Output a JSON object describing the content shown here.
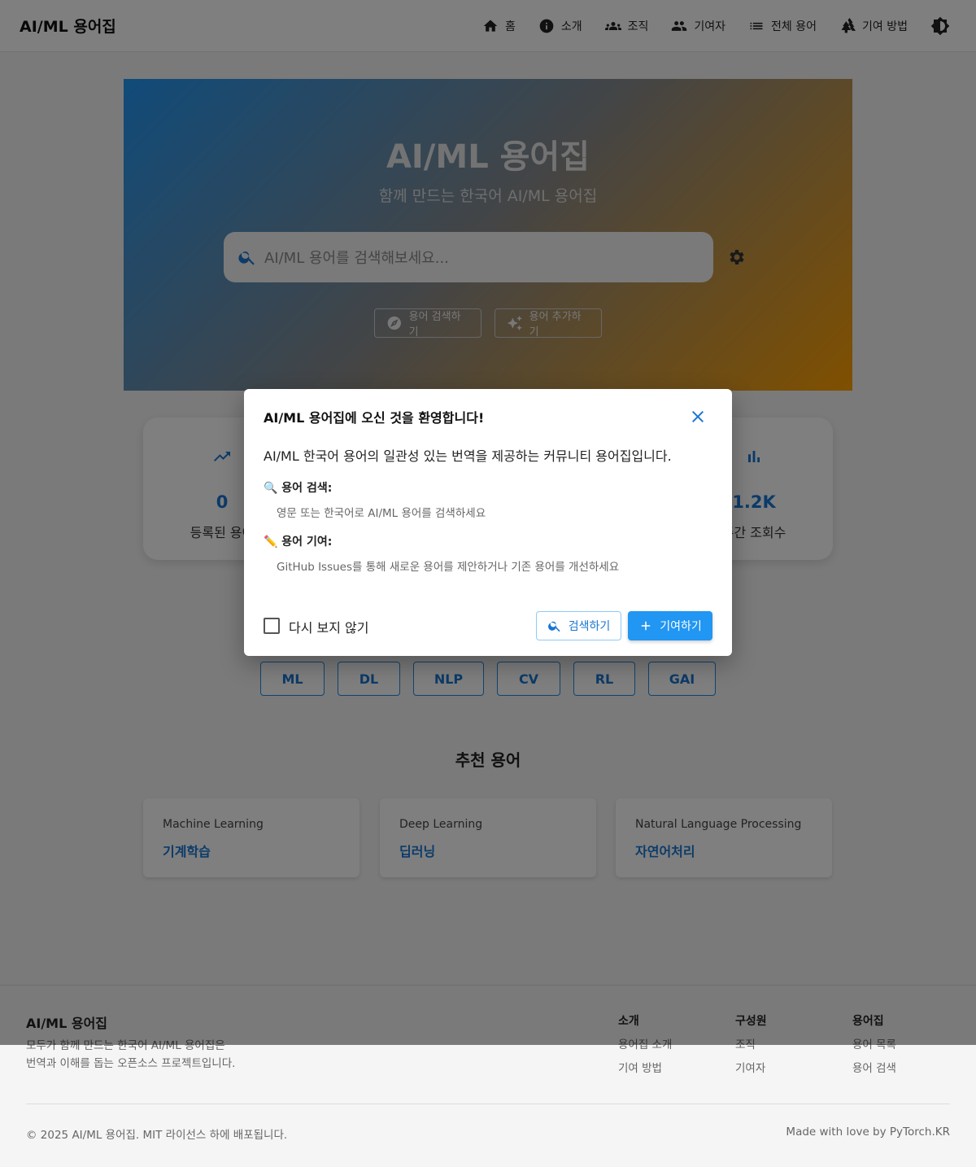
{
  "header": {
    "brand": "AI/ML 용어집",
    "nav": [
      {
        "label": "홈",
        "icon": "home-icon"
      },
      {
        "label": "소개",
        "icon": "info-icon"
      },
      {
        "label": "조직",
        "icon": "groups-icon"
      },
      {
        "label": "기여자",
        "icon": "people-icon"
      },
      {
        "label": "전체 용어",
        "icon": "list-icon"
      },
      {
        "label": "기여 방법",
        "icon": "forest-icon"
      }
    ],
    "theme_icon": "brightness-icon"
  },
  "hero": {
    "title": "AI/ML 용어집",
    "subtitle": "함께 만드는 한국어 AI/ML 용어집",
    "search_placeholder": "AI/ML 용어를 검색해보세요...",
    "explore_label": "용어 검색하기",
    "add_label": "용어 추가하기"
  },
  "stats": [
    {
      "value": "0",
      "label": "등록된 용어",
      "icon": "trending-up-icon"
    },
    {
      "value": "1.2K",
      "label": "주간 조회수",
      "icon": "bar-chart-icon"
    }
  ],
  "categories": [
    "ML",
    "DL",
    "NLP",
    "CV",
    "RL",
    "GAI"
  ],
  "recommended": {
    "title": "추천 용어",
    "terms": [
      {
        "en": "Machine Learning",
        "ko": "기계학습"
      },
      {
        "en": "Deep Learning",
        "ko": "딥러닝"
      },
      {
        "en": "Natural Language Processing",
        "ko": "자연어처리"
      }
    ]
  },
  "dialog": {
    "title": "AI/ML 용어집에 오신 것을 환영합니다!",
    "intro": "AI/ML 한국어 용어의 일관성 있는 번역을 제공하는 커뮤니티 용어집입니다.",
    "search_heading": "🔍 용어 검색:",
    "search_desc": "영문 또는 한국어로 AI/ML 용어를 검색하세요",
    "contribute_heading": "✏️ 용어 기여:",
    "contribute_desc": "GitHub Issues를 통해 새로운 용어를 제안하거나 기존 용어를 개선하세요",
    "dont_show": "다시 보지 않기",
    "search_button": "검색하기",
    "contribute_button": "기여하기"
  },
  "footer": {
    "brand": "AI/ML 용어집",
    "desc_line1": "모두가 함께 만드는 한국어 AI/ML 용어집은",
    "desc_line2": "번역과 이해를 돕는 오픈소스 프로젝트입니다.",
    "columns": [
      {
        "heading": "소개",
        "links": [
          "용어집 소개",
          "기여 방법"
        ]
      },
      {
        "heading": "구성원",
        "links": [
          "조직",
          "기여자"
        ]
      },
      {
        "heading": "용어집",
        "links": [
          "용어 목록",
          "용어 검색"
        ]
      }
    ],
    "copyright": "© 2025 AI/ML 용어집. MIT 라이선스 하에 배포됩니다.",
    "made_with": "Made with love by PyTorch.KR"
  },
  "colors": {
    "primary": "#2196f3",
    "primary_text": "#1976d2",
    "gradient_end": "#ffa000"
  }
}
